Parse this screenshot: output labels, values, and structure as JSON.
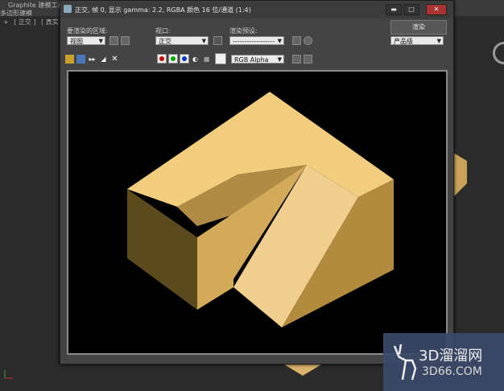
{
  "background": {
    "app_title": "Graphite 建模工具",
    "menu_item": "多边形建模",
    "viewport_labels": [
      "+",
      "[ 正交 ]",
      "[ 真实 ]"
    ]
  },
  "window": {
    "title": "正交, 帧 0, 显示 gamma: 2.2, RGBA 颜色 16 位/通道 (1:4)",
    "minimize": "▬",
    "maximize": "□",
    "close": "✕"
  },
  "controls": {
    "area_label": "要渲染的区域:",
    "area_value": "视图",
    "viewport_label": "视口:",
    "viewport_value": "正交",
    "preset_label": "渲染预设:",
    "preset_value": "------------------",
    "render_button": "渲染",
    "quality_value": "产品级",
    "channel_value": "RGB Alpha"
  },
  "colors": {
    "red": "#cc0000",
    "green": "#00aa00",
    "blue": "#0033cc",
    "face_top": "#f2cd7e",
    "face_left": "#d3a95a",
    "face_front": "#5c4a1f",
    "face_right": "#b38b3e",
    "face_ramp": "#f0cf8e"
  },
  "watermark": {
    "text": "3D溜溜网",
    "url": "3D66.COM"
  }
}
